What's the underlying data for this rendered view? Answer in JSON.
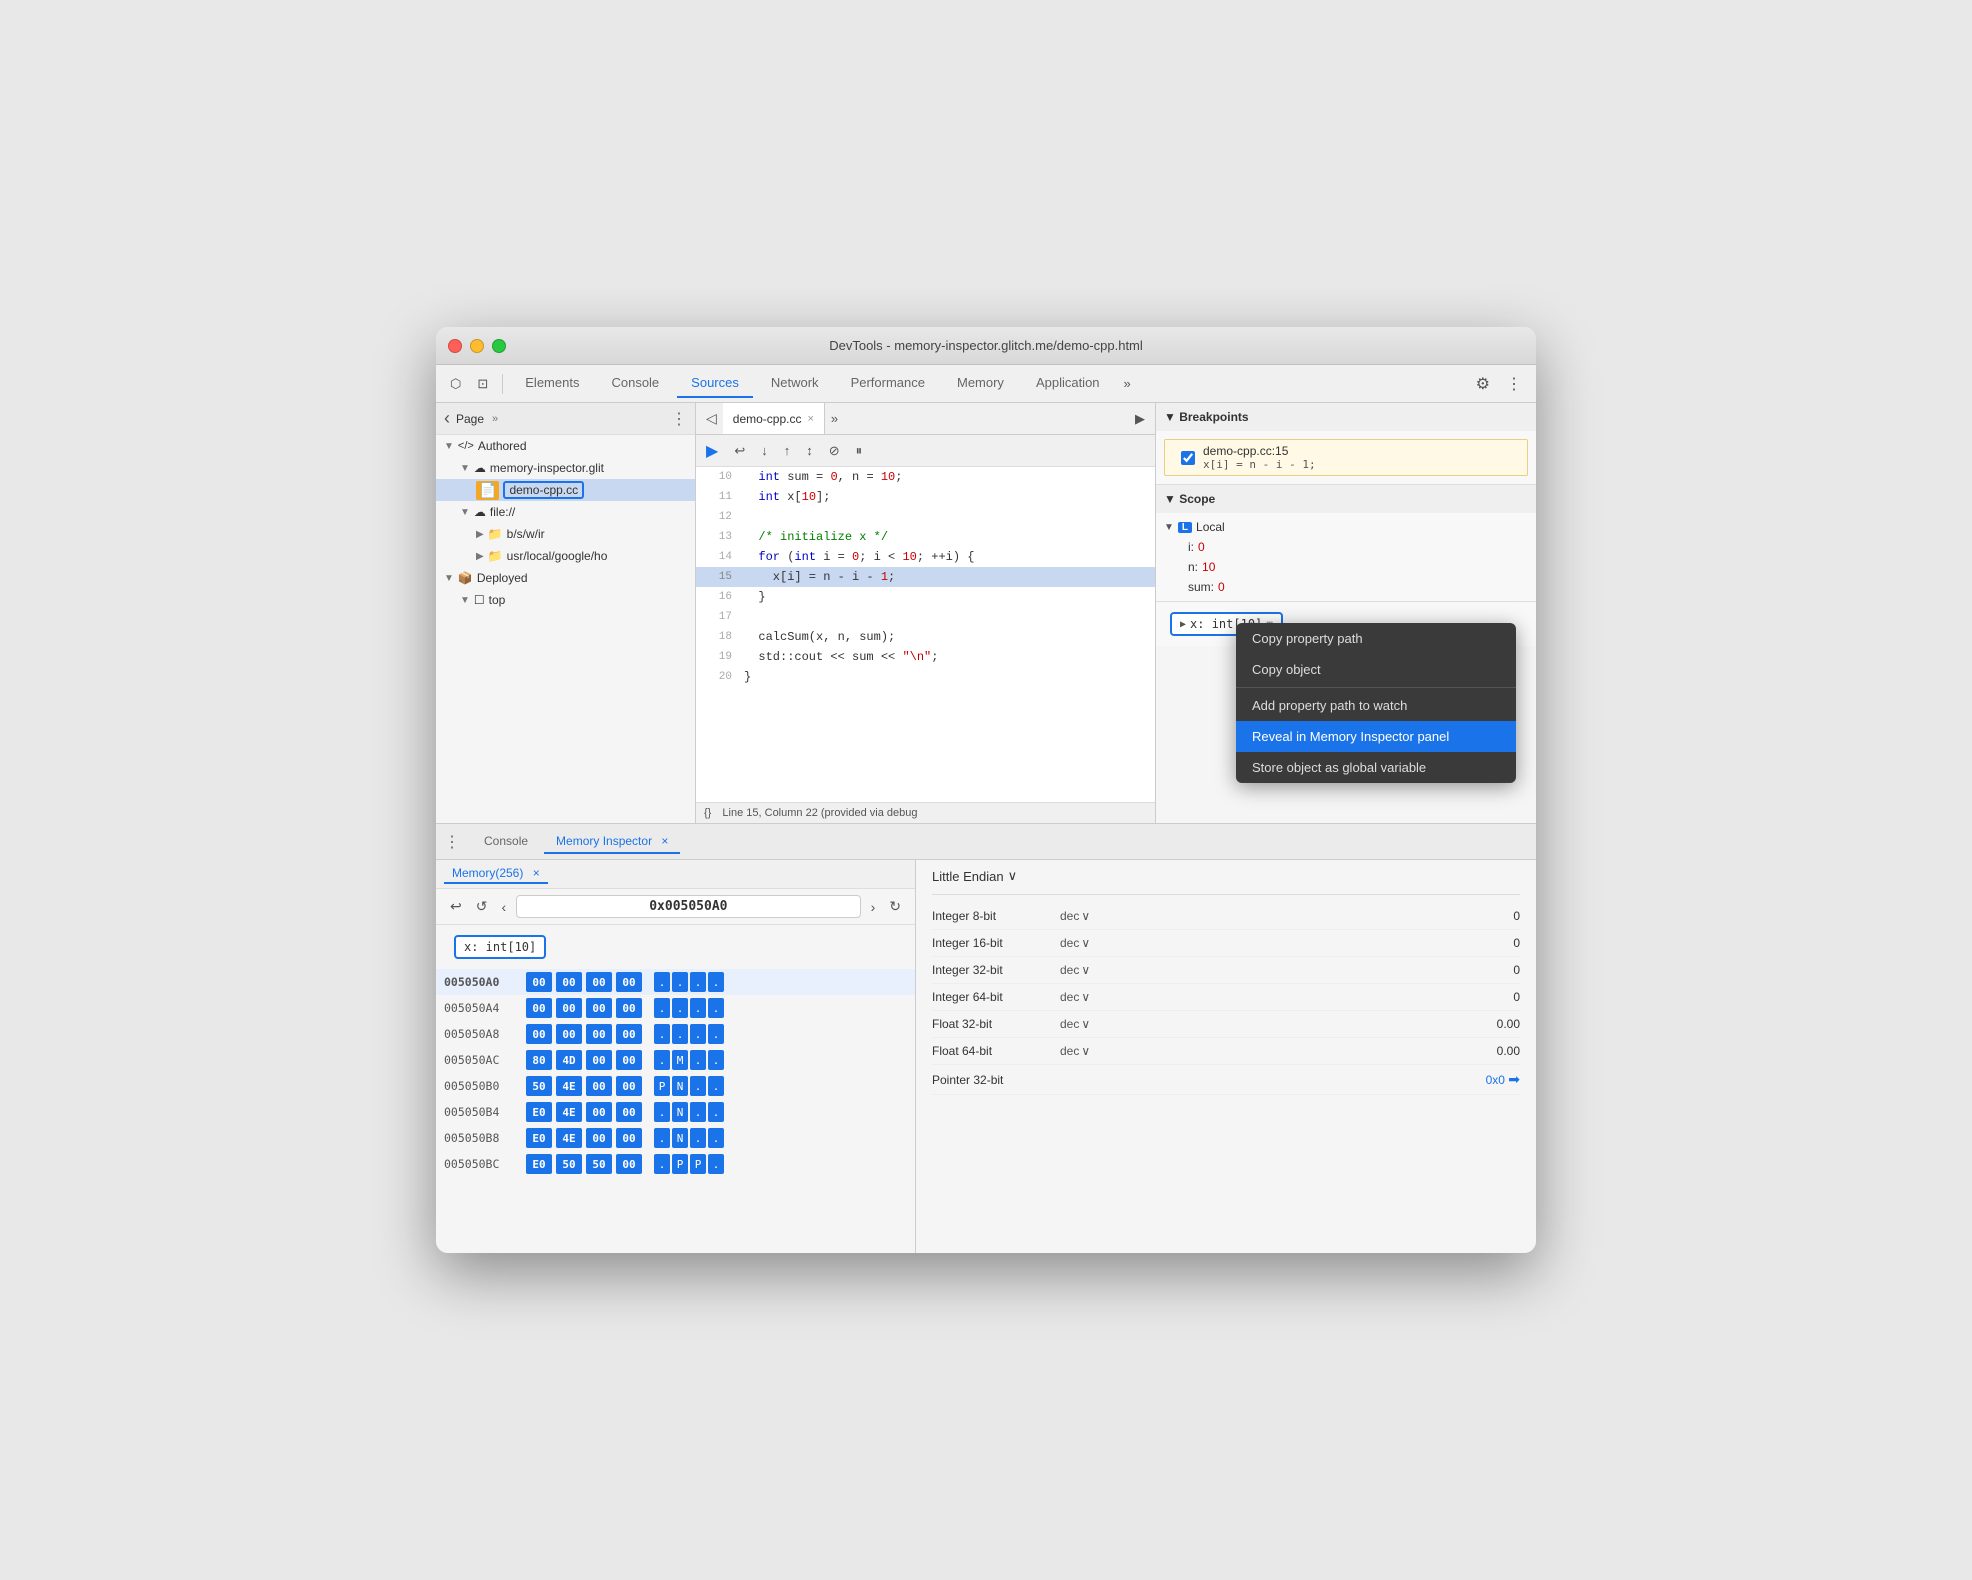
{
  "window": {
    "title": "DevTools - memory-inspector.glitch.me/demo-cpp.html"
  },
  "titlebar": {
    "close": "●",
    "min": "●",
    "max": "●"
  },
  "toolbar": {
    "tabs": [
      "Elements",
      "Console",
      "Sources",
      "Network",
      "Performance",
      "Memory",
      "Application"
    ],
    "active_tab": "Sources",
    "more": "»",
    "settings": "⚙",
    "menu": "⋮"
  },
  "sidebar": {
    "header_label": "Page",
    "more": "»",
    "menu": "⋮",
    "items": [
      {
        "label": "</> Authored",
        "indent": 0,
        "arrow": "▼",
        "icon": ""
      },
      {
        "label": "memory-inspector.glit",
        "indent": 1,
        "arrow": "▼",
        "icon": "☁"
      },
      {
        "label": "demo-cpp.cc",
        "indent": 2,
        "arrow": "",
        "icon": "📄",
        "selected": true
      },
      {
        "label": "file://",
        "indent": 1,
        "arrow": "▼",
        "icon": "☁"
      },
      {
        "label": "b/s/w/ir",
        "indent": 2,
        "arrow": "▶",
        "icon": "📁"
      },
      {
        "label": "usr/local/google/ho",
        "indent": 2,
        "arrow": "▶",
        "icon": "📁"
      },
      {
        "label": "Deployed",
        "indent": 0,
        "arrow": "▼",
        "icon": "📦"
      },
      {
        "label": "top",
        "indent": 1,
        "arrow": "▼",
        "icon": "☐"
      }
    ]
  },
  "code_panel": {
    "tab_label": "demo-cpp.cc",
    "lines": [
      {
        "num": 10,
        "text": "  int sum = 0, n = 10;",
        "highlighted": false
      },
      {
        "num": 11,
        "text": "  int x[10];",
        "highlighted": false
      },
      {
        "num": 12,
        "text": "",
        "highlighted": false
      },
      {
        "num": 13,
        "text": "  /* initialize x */",
        "highlighted": false
      },
      {
        "num": 14,
        "text": "  for (int i = 0; i < 10; ++i) {",
        "highlighted": false
      },
      {
        "num": 15,
        "text": "    x[i] = n - i - 1;",
        "highlighted": true
      },
      {
        "num": 16,
        "text": "  }",
        "highlighted": false
      },
      {
        "num": 17,
        "text": "",
        "highlighted": false
      },
      {
        "num": 18,
        "text": "  calcSum(x, n, sum);",
        "highlighted": false
      },
      {
        "num": 19,
        "text": "  std::cout << sum << \"\\n\";",
        "highlighted": false
      },
      {
        "num": 20,
        "text": "}",
        "highlighted": false
      }
    ],
    "status": "Line 15, Column 22 (provided via debug"
  },
  "breakpoints": {
    "section_label": "▼ Breakpoints",
    "items": [
      {
        "label": "demo-cpp.cc:15",
        "code": "x[i] = n - i - 1;"
      }
    ]
  },
  "scope": {
    "section_label": "▼ Scope",
    "local_label": "▼ Local",
    "local_badge": "L",
    "vars": [
      {
        "name": "i:",
        "value": "0"
      },
      {
        "name": "n:",
        "value": "10"
      },
      {
        "name": "sum:",
        "value": "0"
      }
    ]
  },
  "var_tooltip": {
    "arrow": "▶",
    "label": "x: int[10]",
    "icon": "⊞"
  },
  "context_menu": {
    "items": [
      {
        "label": "Copy property path",
        "active": false,
        "divider": false
      },
      {
        "label": "Copy object",
        "active": false,
        "divider": false
      },
      {
        "label": "",
        "active": false,
        "divider": true
      },
      {
        "label": "Add property path to watch",
        "active": false,
        "divider": false
      },
      {
        "label": "Reveal in Memory Inspector panel",
        "active": true,
        "divider": false
      },
      {
        "label": "Store object as global variable",
        "active": false,
        "divider": false
      }
    ]
  },
  "bottom": {
    "dots": "⋮",
    "tabs": [
      "Console",
      "Memory Inspector"
    ],
    "active_tab": "Memory Inspector",
    "tab_close": "×"
  },
  "memory": {
    "sub_tab": "Memory(256)",
    "sub_tab_close": "×",
    "nav": {
      "back": "↩",
      "forward": "↺",
      "prev": "‹",
      "address": "0x005050A0",
      "next": "›",
      "refresh": "↻"
    },
    "tag": "x: int[10]",
    "rows": [
      {
        "addr": "005050A0",
        "bytes": [
          "00",
          "00",
          "00",
          "00"
        ],
        "chars": [
          ".",
          ".",
          ".",
          ".",
          ".",
          ".",
          ".",
          ".",
          "."
        ],
        "highlighted": true
      },
      {
        "addr": "005050A4",
        "bytes": [
          "00",
          "00",
          "00",
          "00"
        ],
        "chars": [
          ".",
          ".",
          ".",
          ".",
          ".",
          ".",
          ".",
          ".",
          "."
        ],
        "highlighted": false
      },
      {
        "addr": "005050A8",
        "bytes": [
          "00",
          "00",
          "00",
          "00"
        ],
        "chars": [
          ".",
          ".",
          ".",
          ".",
          ".",
          ".",
          ".",
          ".",
          "."
        ],
        "highlighted": false
      },
      {
        "addr": "005050AC",
        "bytes": [
          "80",
          "4D",
          "00",
          "00"
        ],
        "chars": [
          ".",
          "M",
          ".",
          ".",
          ".",
          ".",
          ".",
          ".",
          "M"
        ],
        "highlighted": false
      },
      {
        "addr": "005050B0",
        "bytes": [
          "50",
          "4E",
          "00",
          "00"
        ],
        "chars": [
          "P",
          "N",
          ".",
          ".",
          ".",
          ".",
          ".",
          ".",
          "P"
        ],
        "highlighted": false
      },
      {
        "addr": "005050B4",
        "bytes": [
          "E0",
          "4E",
          "00",
          "00"
        ],
        "chars": [
          ".",
          "N",
          ".",
          ".",
          ".",
          ".",
          ".",
          ".",
          "N"
        ],
        "highlighted": false
      },
      {
        "addr": "005050B8",
        "bytes": [
          "E0",
          "4E",
          "00",
          "00"
        ],
        "chars": [
          ".",
          "N",
          ".",
          ".",
          ".",
          ".",
          ".",
          ".",
          "N"
        ],
        "highlighted": false
      },
      {
        "addr": "005050BC",
        "bytes": [
          "E0",
          "50",
          "50",
          "00"
        ],
        "chars": [
          ".",
          "P",
          "P",
          ".",
          ".",
          ".",
          ".",
          ".",
          "P"
        ],
        "highlighted": false
      }
    ],
    "endian": "Little Endian",
    "types": [
      {
        "label": "Integer 8-bit",
        "format": "dec",
        "value": "0"
      },
      {
        "label": "Integer 16-bit",
        "format": "dec",
        "value": "0"
      },
      {
        "label": "Integer 32-bit",
        "format": "dec",
        "value": "0"
      },
      {
        "label": "Integer 64-bit",
        "format": "dec",
        "value": "0"
      },
      {
        "label": "Float 32-bit",
        "format": "dec",
        "value": "0.00"
      },
      {
        "label": "Float 64-bit",
        "format": "dec",
        "value": "0.00"
      },
      {
        "label": "Pointer 32-bit",
        "format": "",
        "value": "0x0"
      }
    ]
  }
}
